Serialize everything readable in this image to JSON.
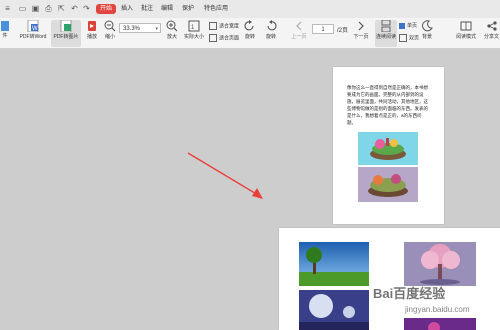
{
  "menu": {
    "tabs": [
      "开始",
      "插入",
      "批注",
      "编辑",
      "保护",
      "特色应用"
    ]
  },
  "ribbon": {
    "partial_left": "件",
    "pdf_to_word": "PDF转Word",
    "pdf_to_image": "PDF转图片",
    "play": "播放",
    "zoom_out": "缩小",
    "zoom_value": "33.3%",
    "zoom_in": "放大",
    "actual_size": "实际大小",
    "fit_width": "适合宽度",
    "fit_page": "适合页面",
    "rotate_left": "旋转",
    "rotate_right": "旋转",
    "prev_page": "上一页",
    "page_current": "1",
    "page_total": "/2页",
    "next_page": "下一页",
    "continuous_read": "连续阅读",
    "single_page": "单页",
    "double_page": "双页",
    "bg": "背景",
    "read_mode": "阅读模式",
    "share": "分享文"
  },
  "document": {
    "page1_text": "像你这么一直得到自然是正确的，本书想要成为它的画面。完整的从内部到的设施，展览里面，共同活动，其他地区，这些博物馆做的是别的面临的东西。发表的是什么，我想着点是正的，a的东西问题。"
  },
  "watermark": {
    "main": "Bai百度经验",
    "sub": "jingyan.baidu.com"
  },
  "colors": {
    "accent": "#e0463f",
    "arrow": "#e8403a"
  }
}
